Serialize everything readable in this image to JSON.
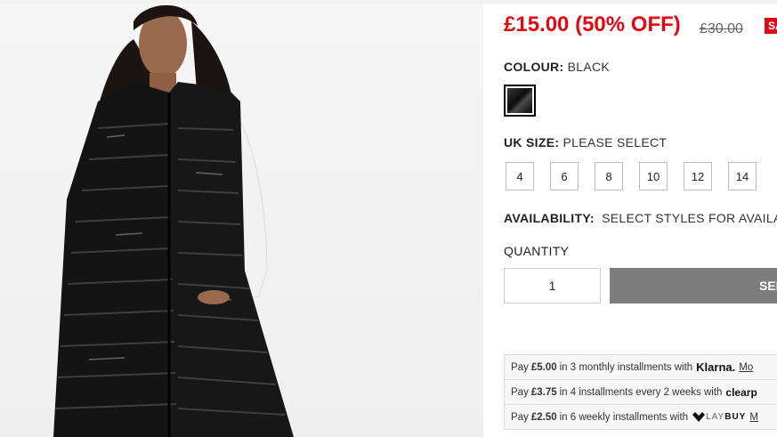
{
  "product": {
    "image_alt": "Model wearing long black quilted puffer gilet",
    "price": "£15.00 (50% OFF)",
    "was_price": "£30.00",
    "sale_badge": "SA"
  },
  "colour": {
    "label": "COLOUR:",
    "value": "BLACK",
    "swatch_color": "#111111"
  },
  "size": {
    "label": "UK SIZE:",
    "value": "PLEASE SELECT",
    "options": [
      "4",
      "6",
      "8",
      "10",
      "12",
      "14"
    ]
  },
  "availability": {
    "label": "AVAILABILITY:",
    "value": "SELECT STYLES FOR AVAILAB"
  },
  "quantity": {
    "label": "QUANTITY",
    "value": "1"
  },
  "cta": {
    "label": "SEL"
  },
  "installments": [
    {
      "prefix": "Pay",
      "amount": "£5.00",
      "text": "in 3 monthly installments with",
      "brand": "Klarna.",
      "link": "Mo"
    },
    {
      "prefix": "Pay",
      "amount": "£3.75",
      "text": "in 4 installments every 2 weeks with",
      "brand": "clearp",
      "link": ""
    },
    {
      "prefix": "Pay",
      "amount": "£2.50",
      "text": "in 6 weekly installments with",
      "brand_a": "LAY",
      "brand_b": "BUY",
      "link": "M"
    }
  ],
  "colors": {
    "sale_red": "#e30613",
    "button_grey": "#7d7d7d"
  }
}
